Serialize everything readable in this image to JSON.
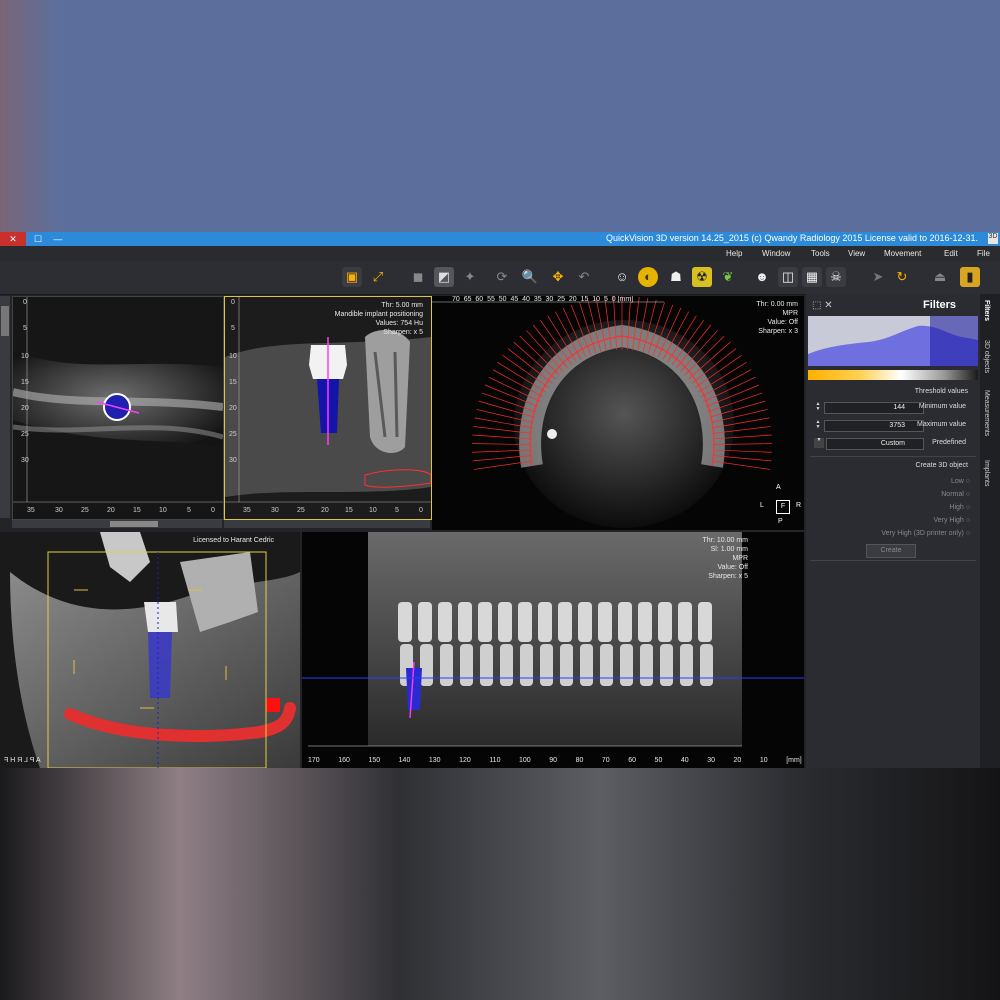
{
  "window": {
    "title": "QuickVision 3D version 14.25_2015 (c) Qwandy Radiology 2015 License valid to 2016-12-31.",
    "min_glyph": "—",
    "max_glyph": "☐",
    "close_glyph": "✕",
    "app_icon": "3D"
  },
  "menu": {
    "file": "File",
    "edit": "Edit",
    "movement": "Movement",
    "view": "View",
    "tools": "Tools",
    "window": "Window",
    "help": "Help"
  },
  "views": {
    "axial": {
      "ruler_left": [
        "0",
        "5",
        "10",
        "15",
        "20",
        "25",
        "30",
        "35"
      ],
      "ruler_bottom": [
        "35",
        "30",
        "25",
        "20",
        "15",
        "10",
        "5",
        "0"
      ]
    },
    "implant": {
      "overlay": [
        "Thr: 5.00 mm",
        "Mandible implant positioning",
        "Values: 754 Hu",
        "Sharpen: x 5"
      ],
      "ruler_left": [
        "0",
        "5",
        "10",
        "15",
        "20",
        "25",
        "30"
      ],
      "ruler_bottom": [
        "35",
        "30",
        "25",
        "20",
        "15",
        "10",
        "5",
        "0"
      ]
    },
    "arch": {
      "overlay": [
        "Thr: 0.00 mm",
        "MPR",
        "Value: Off",
        "Sharpen: x 3"
      ],
      "ruler_top": [
        "0 [mm]",
        "5",
        "10",
        "15",
        "20",
        "25",
        "30",
        "35",
        "40",
        "45",
        "50",
        "55",
        "60",
        "65",
        "70"
      ],
      "orient": {
        "a": "A",
        "r": "R",
        "f": "F",
        "l": "L",
        "p": "P"
      }
    },
    "render3d": {
      "license": "Licensed to Harant Cedric",
      "orient": "A P L R H F"
    },
    "pano": {
      "overlay": [
        "Thr: 10.00 mm",
        "Sl: 1.00 mm",
        "MPR",
        "Value: Off",
        "Sharpen: x 5"
      ],
      "ruler_bottom": [
        "[mm]",
        "10",
        "20",
        "30",
        "40",
        "50",
        "60",
        "70",
        "80",
        "90",
        "100",
        "110",
        "120",
        "130",
        "140",
        "150",
        "160",
        "170"
      ]
    }
  },
  "filters": {
    "title": "Filters",
    "threshold_label": "Threshold values",
    "min_label": "Minimum value",
    "min_value": "144",
    "max_label": "Maximum value",
    "max_value": "3753",
    "predefined_label": "Predefined",
    "predefined_value": "Custom",
    "create_label": "Create 3D object",
    "options": [
      "Low",
      "Normal",
      "High",
      "Very High",
      "Very High (3D printer only)"
    ],
    "create_button": "Create"
  },
  "side_tabs": [
    "Filters",
    "3D objects",
    "Measurements",
    "Implants"
  ],
  "colors": {
    "accent": "#2c8ad8",
    "close": "#c9302c",
    "trace": "#ff2a2a",
    "implant": "#1a1aa8"
  }
}
